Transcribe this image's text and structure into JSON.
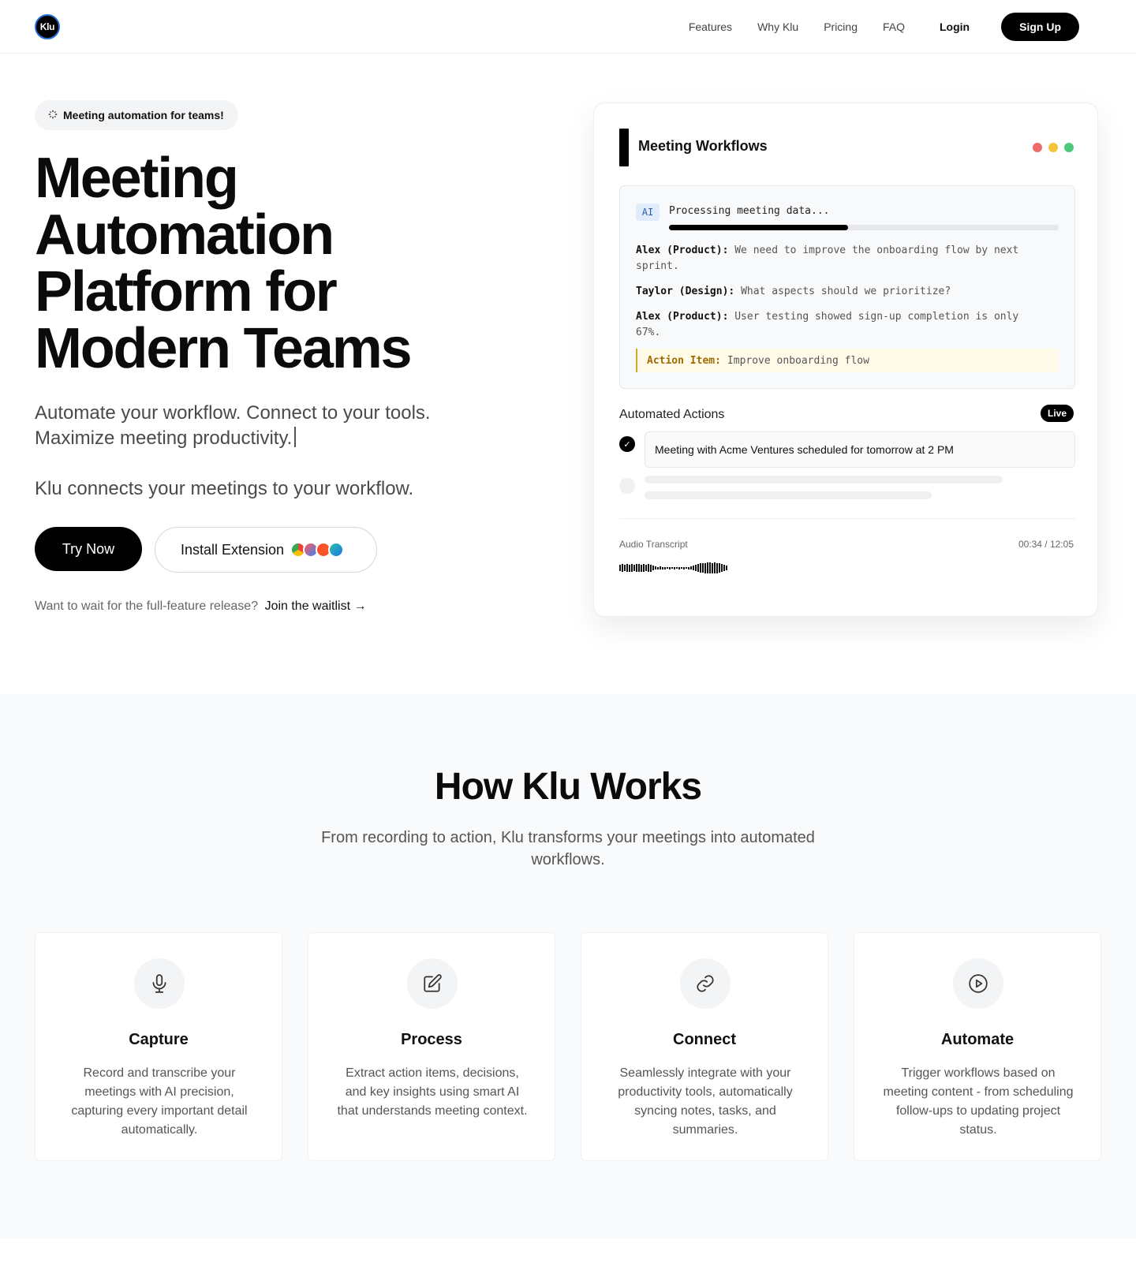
{
  "nav": {
    "logo_text": "Klu",
    "links": [
      "Features",
      "Why Klu",
      "Pricing",
      "FAQ"
    ],
    "login": "Login",
    "signup": "Sign Up"
  },
  "hero": {
    "badge": "Meeting automation for teams!",
    "title_lines": [
      "Meeting",
      "Automation",
      "Platform for",
      "Modern Teams"
    ],
    "subtitle_line1": "Automate your workflow. Connect to your tools.",
    "subtitle_line2": "Maximize meeting productivity.",
    "subtitle2": "Klu connects your meetings to your workflow.",
    "try_button": "Try Now",
    "install_button": "Install Extension",
    "browser_icons": [
      "chrome-icon",
      "arc-icon",
      "brave-icon",
      "edge-icon"
    ],
    "waitlist_text": "Want to wait for the full-feature release?",
    "waitlist_link": "Join the waitlist →"
  },
  "card": {
    "title": "Meeting Workflows",
    "window_dot_colors": [
      "#ef6b6b",
      "#f5c23b",
      "#4cc97a"
    ],
    "ai_badge": "AI",
    "processing_text": "Processing meeting data...",
    "progress_fraction": 0.46,
    "transcript": [
      {
        "speaker": "Alex (Product):",
        "text": "We need to improve the onboarding flow by next sprint."
      },
      {
        "speaker": "Taylor (Design):",
        "text": "What aspects should we prioritize?"
      },
      {
        "speaker": "Alex (Product):",
        "text": "User testing showed sign-up completion is only 67%."
      }
    ],
    "action_item_label": "Action Item:",
    "action_item_text": "Improve onboarding flow",
    "automated_actions_title": "Automated Actions",
    "live_badge": "Live",
    "action_done": "Meeting with Acme Ventures scheduled for tomorrow at 2 PM",
    "audio_label": "Audio Transcript",
    "audio_time": "00:34 / 12:05"
  },
  "how": {
    "title": "How Klu Works",
    "subtitle": "From recording to action, Klu transforms your meetings into automated workflows.",
    "steps": [
      {
        "icon": "microphone-icon",
        "title": "Capture",
        "desc": "Record and transcribe your meetings with AI precision, capturing every important detail automatically."
      },
      {
        "icon": "edit-icon",
        "title": "Process",
        "desc": "Extract action items, decisions, and key insights using smart AI that understands meeting context."
      },
      {
        "icon": "link-icon",
        "title": "Connect",
        "desc": "Seamlessly integrate with your productivity tools, automatically syncing notes, tasks, and summaries."
      },
      {
        "icon": "play-circle-icon",
        "title": "Automate",
        "desc": "Trigger workflows based on meeting content - from scheduling follow-ups to updating project status."
      }
    ]
  }
}
